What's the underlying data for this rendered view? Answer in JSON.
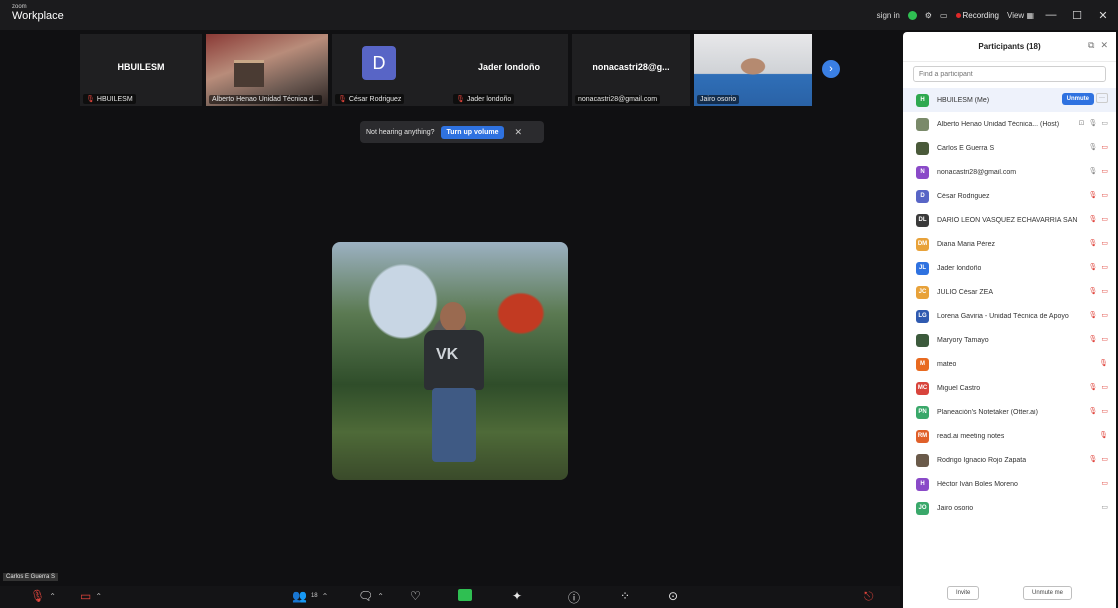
{
  "app": {
    "brand_small": "zoom",
    "brand_big": "Workplace"
  },
  "titlebar": {
    "signin": "sign in",
    "recording": "Recording",
    "view": "View",
    "view_icon": "grid-icon",
    "minimize": "—",
    "maximize": "☐",
    "close": "✕"
  },
  "strip": {
    "tiles": [
      {
        "name": "HBUILESM",
        "label": "HBUILESM"
      },
      {
        "name": "",
        "label": "Alberto Henao Unidad Técnica d..."
      },
      {
        "name": "",
        "label": "César Rodriguez",
        "avatar": "D"
      },
      {
        "name": "Jader londoño",
        "label": "Jader londoño"
      },
      {
        "name": "nonacastri28@g...",
        "label": "nonacastri28@gmail.com"
      },
      {
        "name": "",
        "label": "Jairo osorio"
      }
    ],
    "next_icon": "chevron-right-icon"
  },
  "toast": {
    "text": "Not hearing anything?",
    "button": "Turn up volume",
    "close": "✕"
  },
  "active_speaker": {
    "label": "Carlos E Guerra S"
  },
  "toolbar": {
    "participants_count": "18"
  },
  "panel": {
    "title": "Participants (18)",
    "search_placeholder": "Find a participant",
    "unmute_label": "Unmute",
    "more_label": "···",
    "participants": [
      {
        "initials": "H",
        "color": "#2fa84f",
        "name": "HBUILESM (Me)",
        "me": true,
        "status": ""
      },
      {
        "initials": "",
        "color": "#7a8a6a",
        "name": "Alberto Henao Unidad Técnica... (Host)",
        "status": "host"
      },
      {
        "initials": "",
        "color": "#4a5a3a",
        "name": "Carlos E Guerra S",
        "status": "on"
      },
      {
        "initials": "N",
        "color": "#8a4ac8",
        "name": "nonacastri28@gmail.com",
        "status": "on"
      },
      {
        "initials": "D",
        "color": "#5865c6",
        "name": "César Rodriguez",
        "status": "off"
      },
      {
        "initials": "DL",
        "color": "#3a3a3a",
        "name": "DARIO LEON VASQUEZ ECHAVARRIA SAN...",
        "status": "off"
      },
      {
        "initials": "DM",
        "color": "#e8a23a",
        "name": "Diana Maria Pérez",
        "status": "off"
      },
      {
        "initials": "JL",
        "color": "#2f72e0",
        "name": "Jader londoño",
        "status": "off"
      },
      {
        "initials": "JC",
        "color": "#e8a23a",
        "name": "JULIO César ZEA",
        "status": "off"
      },
      {
        "initials": "LG",
        "color": "#2f5ab0",
        "name": "Lorena Gaviria - Unidad Técnica de Apoyo",
        "status": "off"
      },
      {
        "initials": "",
        "color": "#3c5a3c",
        "name": "Maryory Tamayo",
        "status": "off"
      },
      {
        "initials": "M",
        "color": "#e86a20",
        "name": "mateo",
        "status": "mic-off"
      },
      {
        "initials": "MC",
        "color": "#d8443c",
        "name": "Miguel Castro",
        "status": "off"
      },
      {
        "initials": "PN",
        "color": "#3aa86a",
        "name": "Planeación's Notetaker (Otter.ai)",
        "status": "off"
      },
      {
        "initials": "RM",
        "color": "#e0602a",
        "name": "read.ai meeting notes",
        "status": "mic-off"
      },
      {
        "initials": "",
        "color": "#6a5a4a",
        "name": "Rodrigo Ignacio Rojo Zapata",
        "status": "off"
      },
      {
        "initials": "H",
        "color": "#8a4ac8",
        "name": "Héctor Iván Boles Moreno",
        "status": "video-off"
      },
      {
        "initials": "JO",
        "color": "#3aa86a",
        "name": "Jairo osorio",
        "status": "video"
      }
    ],
    "invite_label": "Invite",
    "unmute_me_label": "Unmute me"
  }
}
